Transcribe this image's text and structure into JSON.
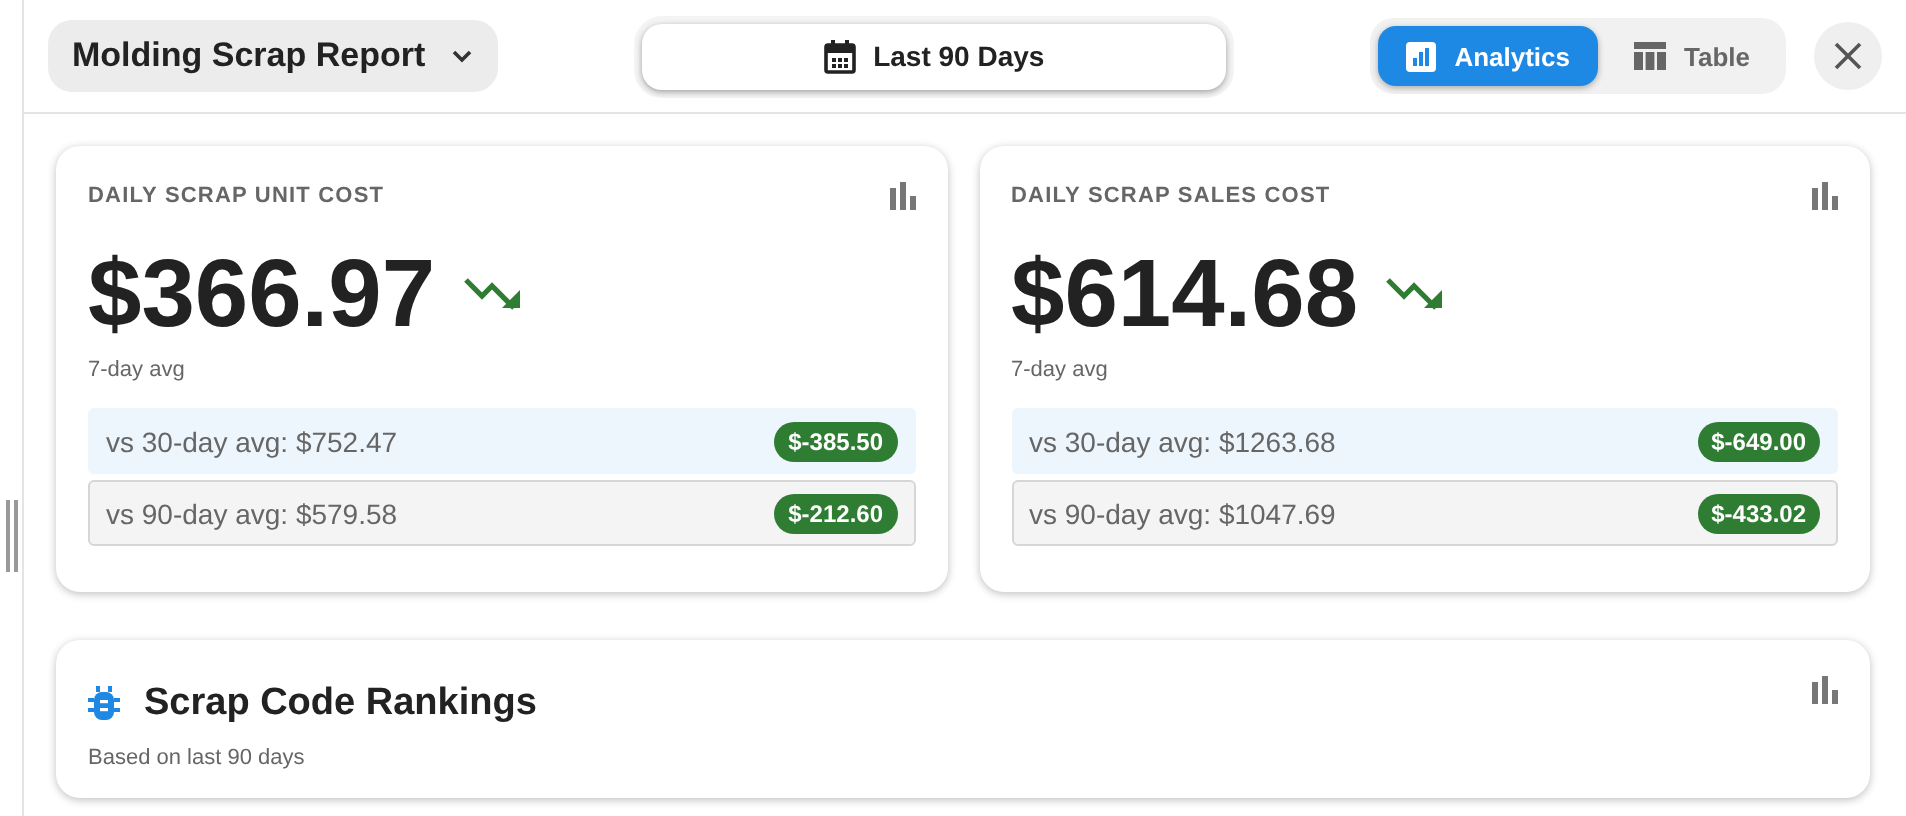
{
  "header": {
    "report_selector": "Molding Scrap Report",
    "date_range": "Last 90 Days",
    "view_tabs": [
      {
        "label": "Analytics",
        "kind": "chart",
        "selected": true
      },
      {
        "label": "Table",
        "kind": "table",
        "selected": false
      }
    ]
  },
  "metric_cards": [
    {
      "title": "DAILY SCRAP UNIT COST",
      "value": "$366.97",
      "kind": "down",
      "caption": "7-day avg",
      "comparisons": [
        {
          "label": "vs 30-day avg: $752.47",
          "delta": "$-385.50",
          "highlighted": true
        },
        {
          "label": "vs 90-day avg: $579.58",
          "delta": "$-212.60",
          "highlighted": false
        }
      ]
    },
    {
      "title": "DAILY SCRAP SALES COST",
      "value": "$614.68",
      "kind": "down",
      "caption": "7-day avg",
      "comparisons": [
        {
          "label": "vs 30-day avg: $1263.68",
          "delta": "$-649.00",
          "highlighted": true
        },
        {
          "label": "vs 90-day avg: $1047.69",
          "delta": "$-433.02",
          "highlighted": false
        }
      ]
    }
  ],
  "rankings": {
    "title": "Scrap Code Rankings",
    "subtitle": "Based on last 90 days"
  }
}
